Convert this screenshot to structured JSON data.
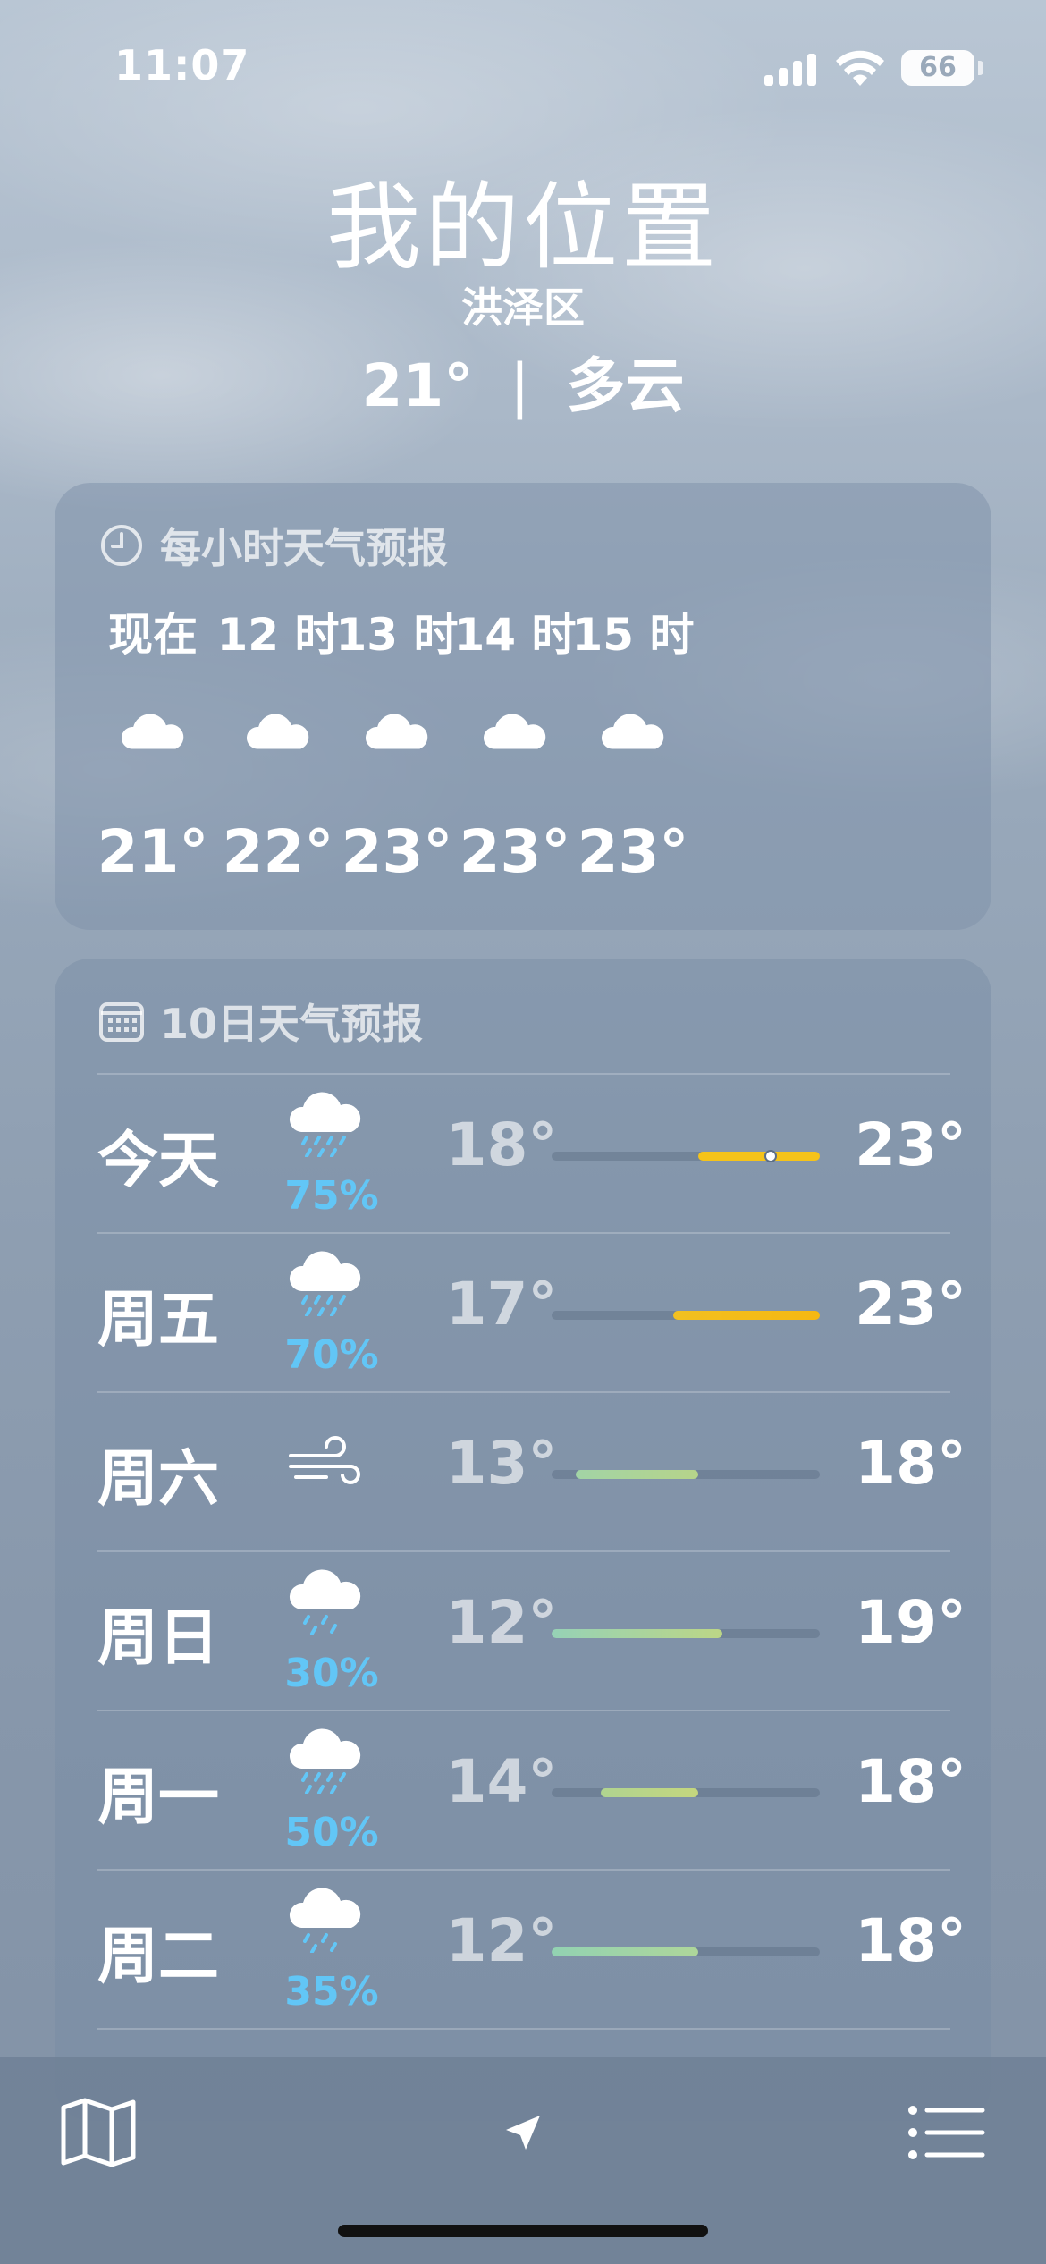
{
  "status_bar": {
    "time": "11:07",
    "battery": "66",
    "signal_icon": "cellular-signal-icon",
    "wifi_icon": "wifi-icon"
  },
  "location": {
    "title": "我的位置",
    "subtitle": "洪泽区",
    "temp": "21°",
    "separator": "|",
    "condition": "多云"
  },
  "hourly": {
    "title": "每小时天气预报",
    "icon": "clock-icon",
    "items": [
      {
        "label": "现在",
        "temp": "21°",
        "icon": "cloud-icon"
      },
      {
        "label": "12 时",
        "temp": "22°",
        "icon": "cloud-icon"
      },
      {
        "label": "13 时",
        "temp": "23°",
        "icon": "cloud-icon"
      },
      {
        "label": "14 时",
        "temp": "23°",
        "icon": "cloud-icon"
      },
      {
        "label": "15 时",
        "temp": "23°",
        "icon": "cloud-icon"
      }
    ]
  },
  "daily": {
    "title": "10日天气预报",
    "icon": "calendar-icon",
    "range": [
      12,
      23
    ],
    "current_temp": 21,
    "items": [
      {
        "day": "今天",
        "icon": "cloud-rain-icon",
        "precip": "75%",
        "low": "18°",
        "high": "23°",
        "low_val": 18,
        "high_val": 23,
        "colors": [
          "#f5c31a",
          "#f5c31a"
        ],
        "current": true
      },
      {
        "day": "周五",
        "icon": "cloud-rain-icon",
        "precip": "70%",
        "low": "17°",
        "high": "23°",
        "low_val": 17,
        "high_val": 23,
        "colors": [
          "#f2c020",
          "#f5b812"
        ],
        "current": false
      },
      {
        "day": "周六",
        "icon": "wind-icon",
        "precip": "",
        "low": "13°",
        "high": "18°",
        "low_val": 13,
        "high_val": 18,
        "colors": [
          "#a2d4a6",
          "#b6d48a"
        ],
        "current": false
      },
      {
        "day": "周日",
        "icon": "cloud-drizzle-icon",
        "precip": "30%",
        "low": "12°",
        "high": "19°",
        "low_val": 12,
        "high_val": 19,
        "colors": [
          "#96d2b6",
          "#bcd686"
        ],
        "current": false
      },
      {
        "day": "周一",
        "icon": "cloud-rain-icon",
        "precip": "50%",
        "low": "14°",
        "high": "18°",
        "low_val": 14,
        "high_val": 18,
        "colors": [
          "#b0d490",
          "#c4d67e"
        ],
        "current": false
      },
      {
        "day": "周二",
        "icon": "cloud-drizzle-icon",
        "precip": "35%",
        "low": "12°",
        "high": "18°",
        "low_val": 12,
        "high_val": 18,
        "colors": [
          "#92d2b2",
          "#aed69a"
        ],
        "current": false
      }
    ]
  },
  "bottom_bar": {
    "map_icon": "map-icon",
    "location_icon": "location-arrow-icon",
    "list_icon": "list-icon"
  }
}
